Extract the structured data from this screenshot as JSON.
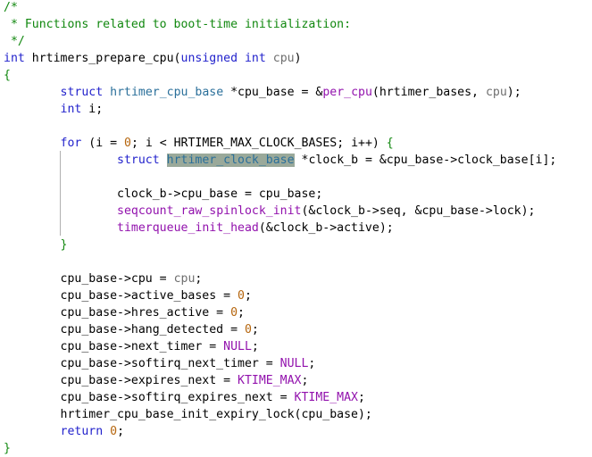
{
  "editor": {
    "lines": [
      [
        {
          "t": "/*",
          "c": "comment"
        }
      ],
      [
        {
          "t": " * Functions related to boot-time initialization:",
          "c": "comment"
        }
      ],
      [
        {
          "t": " */",
          "c": "comment"
        }
      ],
      [
        {
          "t": "int",
          "c": "keyword"
        },
        {
          "t": " hrtimers_prepare_cpu(",
          "c": "plain"
        },
        {
          "t": "unsigned",
          "c": "keyword"
        },
        {
          "t": " ",
          "c": "plain"
        },
        {
          "t": "int",
          "c": "keyword"
        },
        {
          "t": " ",
          "c": "plain"
        },
        {
          "t": "cpu",
          "c": "var"
        },
        {
          "t": ")",
          "c": "plain"
        }
      ],
      [
        {
          "t": "{",
          "c": "brace"
        }
      ],
      [
        {
          "t": "        ",
          "c": "plain"
        },
        {
          "t": "struct",
          "c": "keyword"
        },
        {
          "t": " ",
          "c": "plain"
        },
        {
          "t": "hrtimer_cpu_base",
          "c": "type"
        },
        {
          "t": " *cpu_base = &",
          "c": "plain"
        },
        {
          "t": "per_cpu",
          "c": "func"
        },
        {
          "t": "(hrtimer_bases, ",
          "c": "plain"
        },
        {
          "t": "cpu",
          "c": "var"
        },
        {
          "t": ");",
          "c": "plain"
        }
      ],
      [
        {
          "t": "        ",
          "c": "plain"
        },
        {
          "t": "int",
          "c": "keyword"
        },
        {
          "t": " i;",
          "c": "plain"
        }
      ],
      [],
      [
        {
          "t": "        ",
          "c": "plain"
        },
        {
          "t": "for",
          "c": "keyword"
        },
        {
          "t": " (i = ",
          "c": "plain"
        },
        {
          "t": "0",
          "c": "number"
        },
        {
          "t": "; i < HRTIMER_MAX_CLOCK_BASES; i++) ",
          "c": "plain"
        },
        {
          "t": "{",
          "c": "brace"
        }
      ],
      [
        {
          "t": "                ",
          "c": "plain"
        },
        {
          "t": "struct",
          "c": "keyword"
        },
        {
          "t": " ",
          "c": "plain"
        },
        {
          "t": "hrtimer_clock_base",
          "c": "type",
          "sel": true
        },
        {
          "t": " *clock_b = &cpu_base->clock_base[i];",
          "c": "plain"
        }
      ],
      [],
      [
        {
          "t": "                clock_b->cpu_base = cpu_base;",
          "c": "plain"
        }
      ],
      [
        {
          "t": "                ",
          "c": "plain"
        },
        {
          "t": "seqcount_raw_spinlock_init",
          "c": "func"
        },
        {
          "t": "(&clock_b->seq, &cpu_base->lock);",
          "c": "plain"
        }
      ],
      [
        {
          "t": "                ",
          "c": "plain"
        },
        {
          "t": "timerqueue_init_head",
          "c": "func"
        },
        {
          "t": "(&clock_b->active);",
          "c": "plain"
        }
      ],
      [
        {
          "t": "        ",
          "c": "plain"
        },
        {
          "t": "}",
          "c": "brace"
        }
      ],
      [],
      [
        {
          "t": "        cpu_base->cpu = ",
          "c": "plain"
        },
        {
          "t": "cpu",
          "c": "var"
        },
        {
          "t": ";",
          "c": "plain"
        }
      ],
      [
        {
          "t": "        cpu_base->active_bases = ",
          "c": "plain"
        },
        {
          "t": "0",
          "c": "number"
        },
        {
          "t": ";",
          "c": "plain"
        }
      ],
      [
        {
          "t": "        cpu_base->hres_active = ",
          "c": "plain"
        },
        {
          "t": "0",
          "c": "number"
        },
        {
          "t": ";",
          "c": "plain"
        }
      ],
      [
        {
          "t": "        cpu_base->hang_detected = ",
          "c": "plain"
        },
        {
          "t": "0",
          "c": "number"
        },
        {
          "t": ";",
          "c": "plain"
        }
      ],
      [
        {
          "t": "        cpu_base->next_timer = ",
          "c": "plain"
        },
        {
          "t": "NULL",
          "c": "const"
        },
        {
          "t": ";",
          "c": "plain"
        }
      ],
      [
        {
          "t": "        cpu_base->softirq_next_timer = ",
          "c": "plain"
        },
        {
          "t": "NULL",
          "c": "const"
        },
        {
          "t": ";",
          "c": "plain"
        }
      ],
      [
        {
          "t": "        cpu_base->expires_next = ",
          "c": "plain"
        },
        {
          "t": "KTIME_MAX",
          "c": "const"
        },
        {
          "t": ";",
          "c": "plain"
        }
      ],
      [
        {
          "t": "        cpu_base->softirq_expires_next = ",
          "c": "plain"
        },
        {
          "t": "KTIME_MAX",
          "c": "const"
        },
        {
          "t": ";",
          "c": "plain"
        }
      ],
      [
        {
          "t": "        hrtimer_cpu_base_init_expiry_lock(cpu_base);",
          "c": "plain"
        }
      ],
      [
        {
          "t": "        ",
          "c": "plain"
        },
        {
          "t": "return",
          "c": "keyword"
        },
        {
          "t": " ",
          "c": "plain"
        },
        {
          "t": "0",
          "c": "number"
        },
        {
          "t": ";",
          "c": "plain"
        }
      ],
      [
        {
          "t": "}",
          "c": "brace"
        }
      ]
    ]
  }
}
